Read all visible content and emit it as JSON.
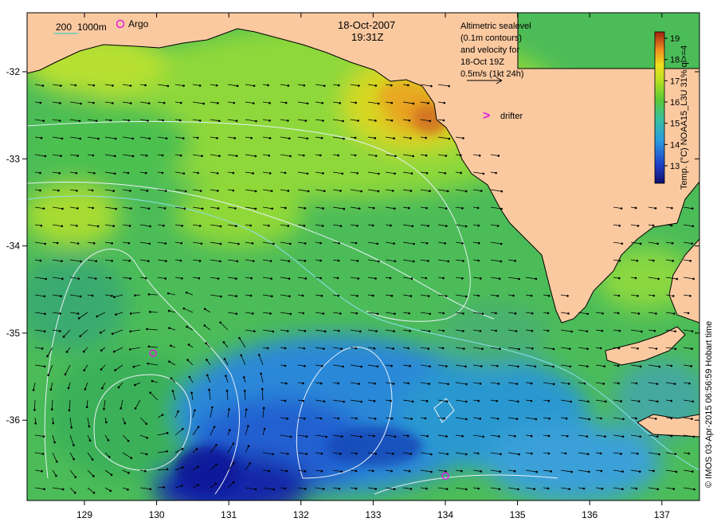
{
  "map": {
    "date_label": "18-Oct-2007",
    "time_label": "19:31Z",
    "scale_bar_label": "200",
    "depth_label": "1000m",
    "argo_legend_label": "Argo",
    "altimetry_note": [
      "Altimetric sealevel",
      "(0.1m contours)",
      "and velocity for",
      "18-Oct 19Z",
      "0.5m/s (1kt 24h)"
    ],
    "drifter_legend_label": "drifter",
    "drifter_symbol": ">",
    "colorbar_title": "Temp. (°C) NOAA15_L3U 31% ql>=4",
    "colorbar_ticks": [
      "13",
      "14",
      "15",
      "16",
      "17",
      "18",
      "19"
    ],
    "credit": "© IMOS 03-Apr-2015 06:56:59 Hobart time",
    "longitude_ticks": [
      "129",
      "130",
      "131",
      "132",
      "133",
      "134",
      "135",
      "136",
      "137"
    ],
    "latitude_ticks": [
      "-32",
      "-33",
      "-34",
      "-35",
      "-36"
    ],
    "argo_floats": [
      {
        "lon": 129.95,
        "lat": -35.23
      },
      {
        "lon": 134.0,
        "lat": -36.64
      }
    ],
    "colors": {
      "land": "#fbc9a0",
      "argo": "#e020e0",
      "contour": "#e8f0f8",
      "isobath": "#8fdff0",
      "warm": "#d88a10",
      "green": "#55c535",
      "cool": "#2a90d8",
      "deep": "#1828a8"
    }
  }
}
